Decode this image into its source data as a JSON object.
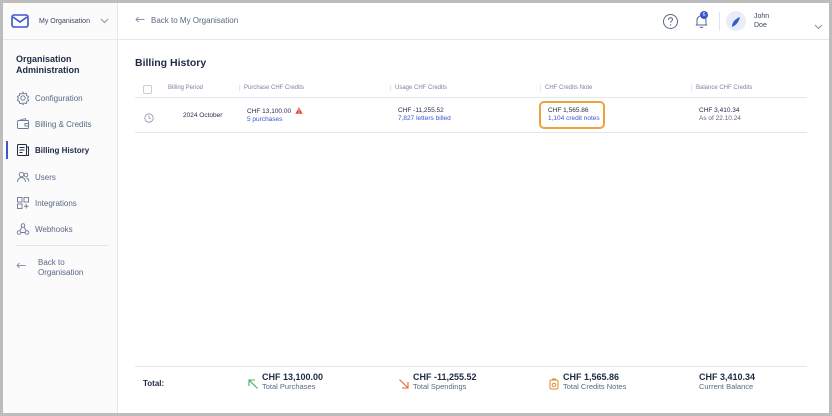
{
  "org_switcher": {
    "name": "My Organisation"
  },
  "header": {
    "back_label": "Back to My Organisation",
    "notification_count": "6",
    "user_first": "John",
    "user_last": "Doe"
  },
  "sidebar": {
    "title": "Organisation Administration",
    "items": [
      {
        "label": "Configuration",
        "icon": "gear-icon"
      },
      {
        "label": "Billing & Credits",
        "icon": "wallet-icon"
      },
      {
        "label": "Billing History",
        "icon": "invoice-icon",
        "active": true
      },
      {
        "label": "Users",
        "icon": "users-icon"
      },
      {
        "label": "Integrations",
        "icon": "integrations-icon"
      },
      {
        "label": "Webhooks",
        "icon": "webhook-icon"
      }
    ],
    "back_label": "Back to Organisation"
  },
  "page": {
    "title": "Billing History"
  },
  "table": {
    "headers": [
      "Billing Period",
      "Purchase CHF Credits",
      "Usage CHF Credits",
      "CHF Credits Note",
      "Balance CHF Credits"
    ],
    "rows": [
      {
        "period": "2024 October",
        "purchase_amount": "CHF 13,100.00",
        "purchase_link": "5 purchases",
        "usage_amount": "CHF -11,255.52",
        "usage_link": "7,827 letters billed",
        "note_amount": "CHF 1,565.86",
        "note_link": "1,104 credit notes",
        "balance_amount": "CHF 3,410.34",
        "balance_date": "As of 22.10.24"
      }
    ]
  },
  "totals": {
    "label": "Total:",
    "purchases_value": "CHF 13,100.00",
    "purchases_label": "Total Purchases",
    "spendings_value": "CHF -11,255.52",
    "spendings_label": "Total Spendings",
    "notes_value": "CHF 1,565.86",
    "notes_label": "Total Credits Notes",
    "balance_value": "CHF 3,410.34",
    "balance_label": "Current Balance"
  },
  "colors": {
    "accent": "#3c54d6",
    "highlight": "#f0a23a",
    "purchase_arrow": "#3fae5b",
    "spending_arrow": "#e36a2e",
    "warning": "#e04a3b"
  }
}
